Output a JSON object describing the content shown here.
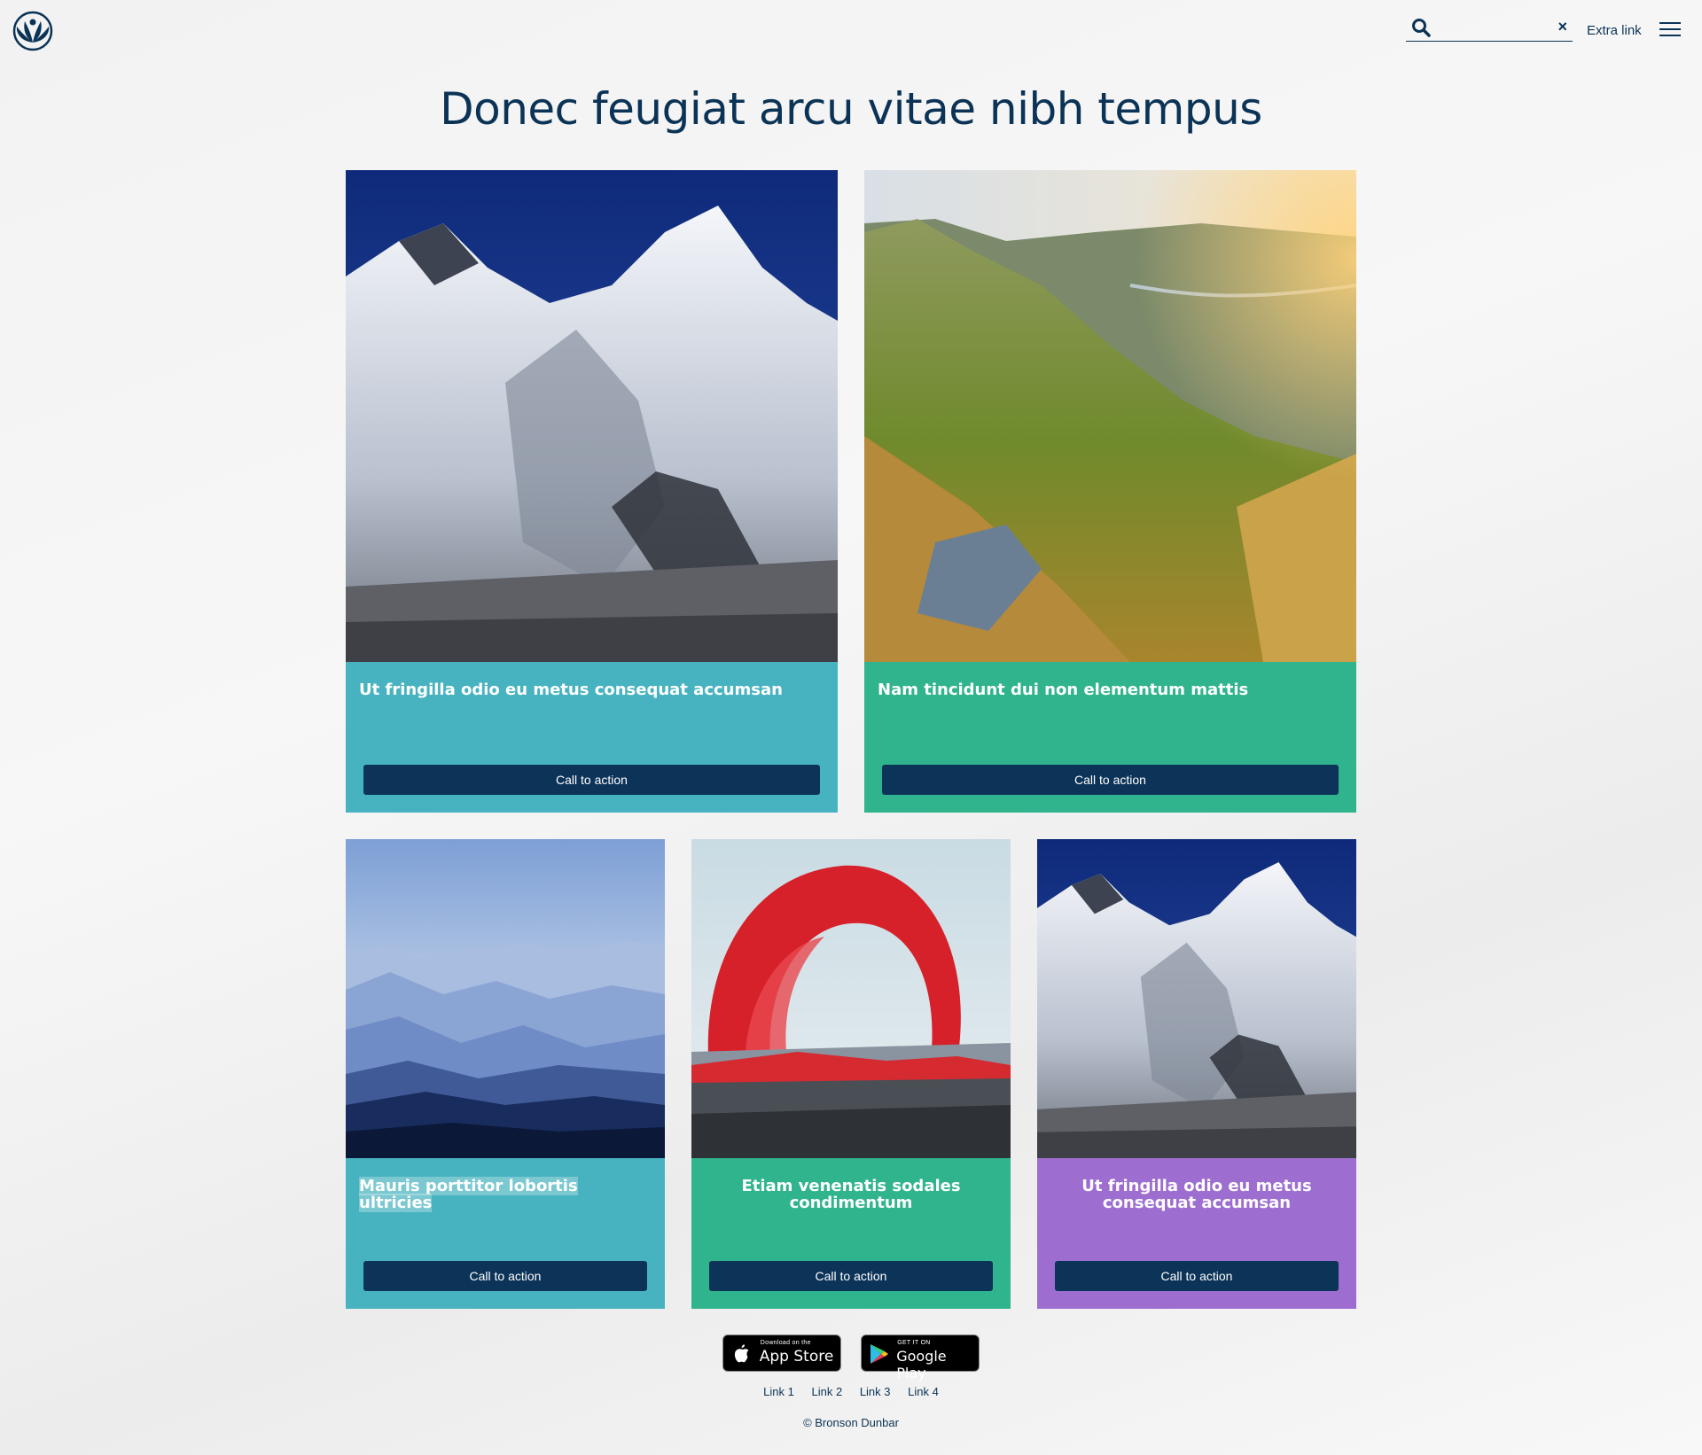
{
  "header": {
    "search": {
      "value": "",
      "placeholder": ""
    },
    "extra_link": "Extra link"
  },
  "main": {
    "title": "Donec feugiat arcu vitae nibh tempus",
    "cards": [
      {
        "title": "Ut fringilla odio eu metus consequat accumsan",
        "cta": "Call to action",
        "color": "#48b3c0",
        "image": "snowy-mountain"
      },
      {
        "title": "Nam tincidunt dui non elementum mattis",
        "cta": "Call to action",
        "color": "#30b48d",
        "image": "green-valley"
      },
      {
        "title": "Mauris porttitor lobortis ultricies",
        "cta": "Call to action",
        "color": "#48b3c0",
        "image": "misty-blue-mountains"
      },
      {
        "title": "Etiam venenatis sodales condimentum",
        "cta": "Call to action",
        "color": "#30b48d",
        "image": "lava-fountain"
      },
      {
        "title": "Ut fringilla odio eu metus consequat accumsan",
        "cta": "Call to action",
        "color": "#9d6ed0",
        "image": "snowy-mountain"
      }
    ]
  },
  "footer": {
    "app_store": {
      "small": "Download on the",
      "big": "App Store"
    },
    "google_play": {
      "small": "GET IT ON",
      "big": "Google Play"
    },
    "links": [
      "Link 1",
      "Link 2",
      "Link 3",
      "Link 4"
    ],
    "copyright": "© Bronson Dunbar"
  }
}
